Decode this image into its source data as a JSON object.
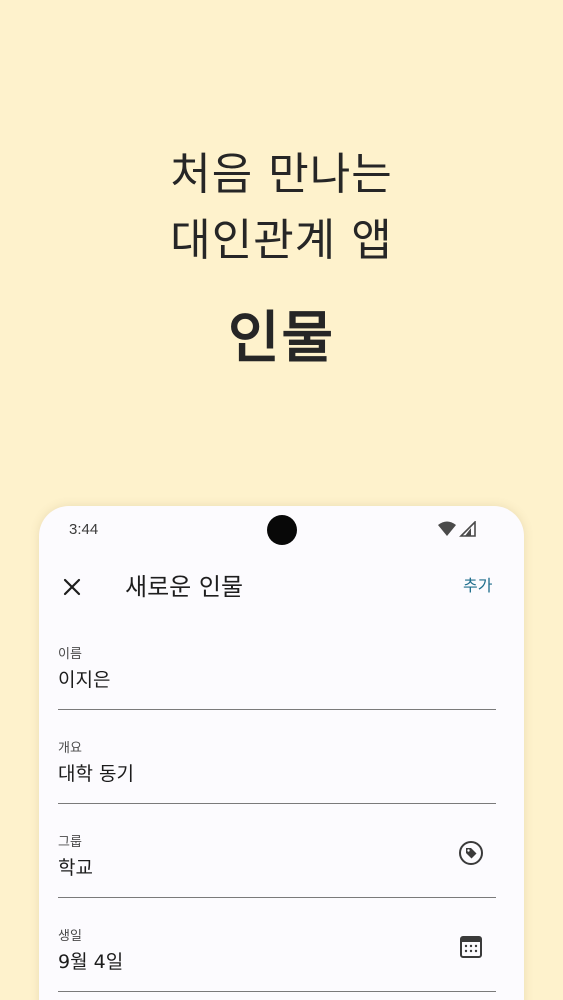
{
  "headline": {
    "line1": "처음 만나는",
    "line2": "대인관계 앱",
    "brand": "인물"
  },
  "status_bar": {
    "time": "3:44",
    "icons": [
      "wifi-icon",
      "signal-icon"
    ]
  },
  "app_bar": {
    "close_icon": "close-icon",
    "title": "새로운 인물",
    "add_label": "추가",
    "accent_color": "#1f6e8c"
  },
  "form": {
    "fields": [
      {
        "label": "이름",
        "value": "이지은"
      },
      {
        "label": "개요",
        "value": "대학 동기"
      },
      {
        "label": "그룹",
        "value": "학교",
        "icon": "tag-icon"
      },
      {
        "label": "생일",
        "value": "9월 4일",
        "icon": "calendar-icon"
      }
    ]
  },
  "colors": {
    "background": "#FEF2CC",
    "surface": "#FCFBFE",
    "text": "#262626"
  }
}
